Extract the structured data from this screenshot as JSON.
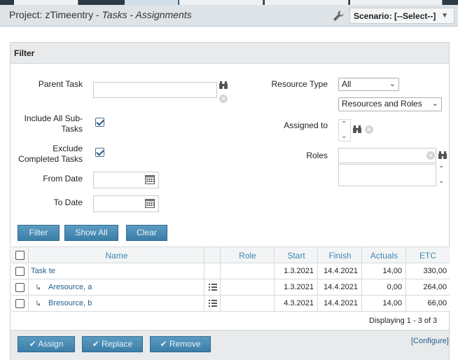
{
  "header": {
    "project_prefix": "Project: zTimeentry - ",
    "section": "Tasks - Assignments",
    "scenario_label": "Scenario: [--Select--]"
  },
  "filter": {
    "title": "Filter",
    "parent_task_label": "Parent Task",
    "include_subtasks_label_1": "Include All Sub-",
    "include_subtasks_label_2": "Tasks",
    "include_subtasks_checked": true,
    "exclude_completed_label_1": "Exclude",
    "exclude_completed_label_2": "Completed Tasks",
    "exclude_completed_checked": true,
    "from_date_label": "From Date",
    "to_date_label": "To Date",
    "resource_type_label": "Resource Type",
    "resource_type_value": "All",
    "resource_kind_value": "Resources and Roles",
    "assigned_to_label": "Assigned to",
    "roles_label": "Roles",
    "buttons": {
      "filter": "Filter",
      "show_all": "Show All",
      "clear": "Clear"
    }
  },
  "grid": {
    "columns": {
      "name": "Name",
      "role": "Role",
      "start": "Start",
      "finish": "Finish",
      "actuals": "Actuals",
      "etc": "ETC"
    },
    "rows": [
      {
        "name": "Task te",
        "child": false,
        "start": "1.3.2021",
        "finish": "14.4.2021",
        "actuals": "14,00",
        "etc": "330,00"
      },
      {
        "name": "Aresource, a",
        "child": true,
        "start": "1.3.2021",
        "finish": "14.4.2021",
        "actuals": "0,00",
        "etc": "264,00"
      },
      {
        "name": "Bresource, b",
        "child": true,
        "start": "4.3.2021",
        "finish": "14.4.2021",
        "actuals": "14,00",
        "etc": "66,00"
      }
    ],
    "displaying": "Displaying 1 - 3 of 3"
  },
  "actions": {
    "assign": "Assign",
    "replace": "Replace",
    "remove": "Remove",
    "configure": "[Configure]"
  },
  "colors": {
    "accent": "#4a8bb5",
    "link": "#1f5f8e",
    "header_bg": "#dde3e6"
  }
}
